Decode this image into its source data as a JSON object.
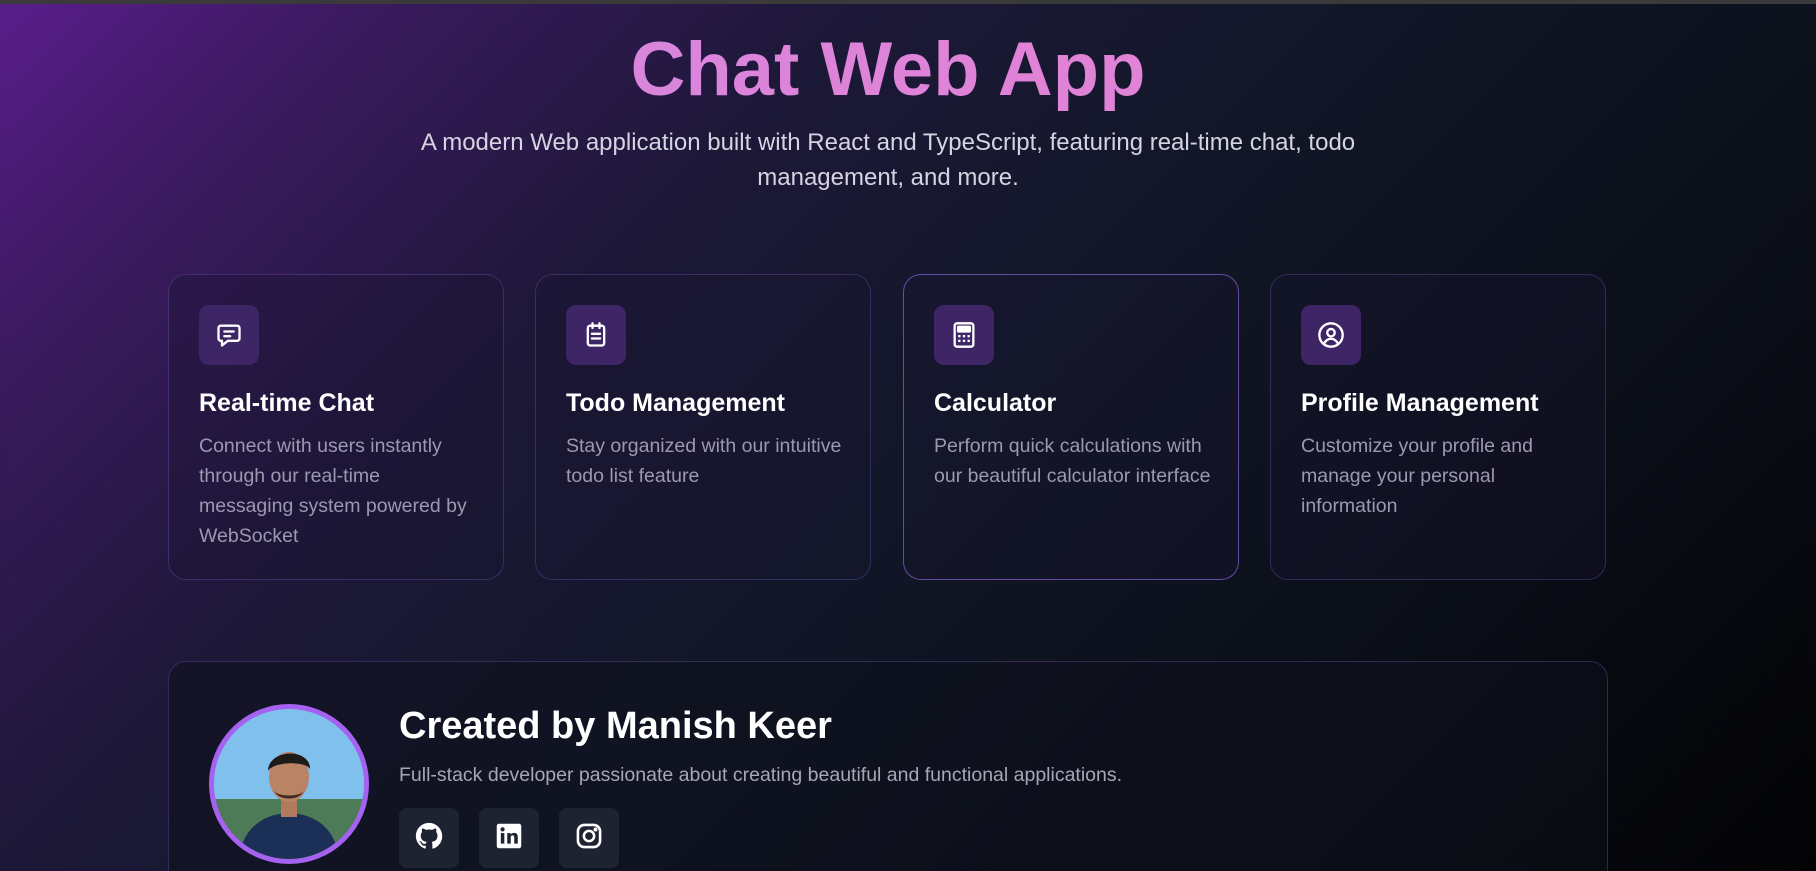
{
  "hero": {
    "title": "Chat Web App",
    "subtitle": "A modern Web application built with React and TypeScript, featuring real-time chat, todo management, and more."
  },
  "features": [
    {
      "title": "Real-time Chat",
      "description": "Connect with users instantly through our real-time messaging system powered by WebSocket",
      "icon": "message-square-icon"
    },
    {
      "title": "Todo Management",
      "description": "Stay organized with our intuitive todo list feature",
      "icon": "clipboard-list-icon"
    },
    {
      "title": "Calculator",
      "description": "Perform quick calculations with our beautiful calculator interface",
      "icon": "calculator-icon"
    },
    {
      "title": "Profile Management",
      "description": "Customize your profile and manage your personal information",
      "icon": "user-circle-icon"
    }
  ],
  "creator": {
    "name": "Created by Manish Keer",
    "bio": "Full-stack developer passionate about creating beautiful and functional applications.",
    "social": [
      "github-icon",
      "linkedin-icon",
      "instagram-icon"
    ]
  },
  "colors": {
    "accent": "#a562f0",
    "title_gradient_start": "#d18ae6",
    "title_gradient_end": "#e88bd0",
    "icon_tile": "#3d2566",
    "social_tile": "#1d2330"
  }
}
